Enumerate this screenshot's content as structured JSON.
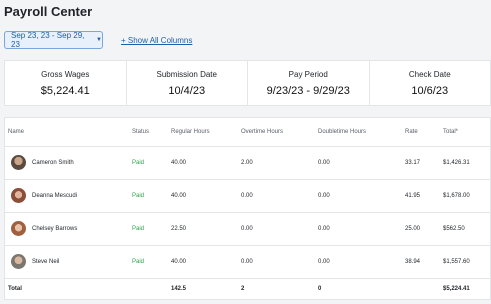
{
  "page_title": "Payroll Center",
  "date_range": "Sep 23, 23 - Sep 29, 23",
  "show_columns_link": "+ Show All Columns",
  "summary": [
    {
      "label": "Gross Wages",
      "value": "$5,224.41"
    },
    {
      "label": "Submission Date",
      "value": "10/4/23"
    },
    {
      "label": "Pay Period",
      "value": "9/23/23 - 9/29/23"
    },
    {
      "label": "Check Date",
      "value": "10/6/23"
    }
  ],
  "columns": [
    "Name",
    "Status",
    "Regular Hours",
    "Overtime Hours",
    "Doubletime Hours",
    "Rate",
    "Total*"
  ],
  "rows": [
    {
      "name": "Cameron Smith",
      "status": "Paid",
      "regular": "40.00",
      "overtime": "2.00",
      "doubletime": "0.00",
      "rate": "33.17",
      "total": "$1,426.31",
      "avatar_color": "#5a4a3f"
    },
    {
      "name": "Deanna Mescudi",
      "status": "Paid",
      "regular": "40.00",
      "overtime": "0.00",
      "doubletime": "0.00",
      "rate": "41.95",
      "total": "$1,678.00",
      "avatar_color": "#8a4f3a"
    },
    {
      "name": "Chelsey Barrows",
      "status": "Paid",
      "regular": "22.50",
      "overtime": "0.00",
      "doubletime": "0.00",
      "rate": "25.00",
      "total": "$562.50",
      "avatar_color": "#a0603f"
    },
    {
      "name": "Steve Neil",
      "status": "Paid",
      "regular": "40.00",
      "overtime": "0.00",
      "doubletime": "0.00",
      "rate": "38.94",
      "total": "$1,557.60",
      "avatar_color": "#7b7670"
    }
  ],
  "totals": {
    "label": "Total",
    "regular": "142.5",
    "overtime": "2",
    "doubletime": "0",
    "total": "$5,224.41"
  },
  "colors": {
    "accent": "#1f5fa8",
    "paid": "#2aa34a"
  }
}
